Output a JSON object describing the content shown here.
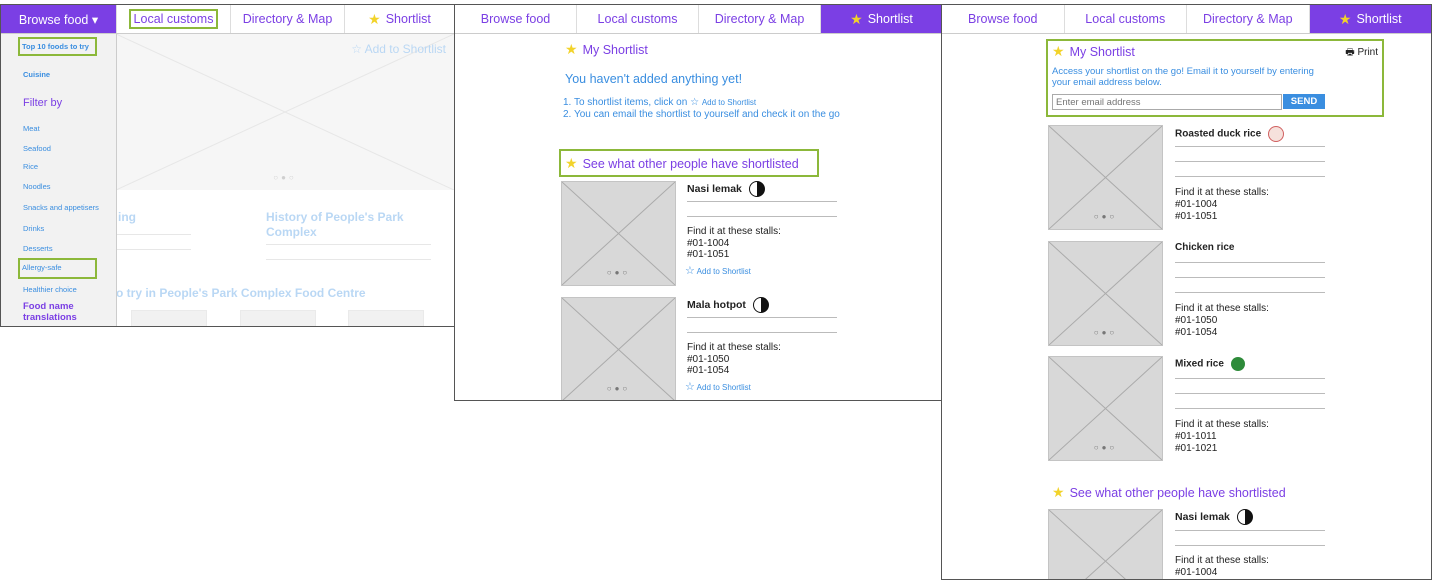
{
  "nav": {
    "browse_food": "Browse food",
    "browse_food_dropdown": "Browse food ▾",
    "local_customs": "Local customs",
    "directory_map": "Directory & Map",
    "shortlist": "Shortlist"
  },
  "panel1": {
    "menu": {
      "top10": "Top 10 foods to try",
      "cuisine": "Cuisine",
      "filter_by": "Filter by",
      "items": [
        "Meat",
        "Seafood",
        "Rice",
        "Noodles",
        "Snacks and appetisers",
        "Drinks",
        "Desserts",
        "Allergy-safe",
        "Healthier choice"
      ],
      "food_name_translations": "Food name translations"
    },
    "add_to_shortlist": "Add to Shortlist",
    "faded_heading_1": "ing",
    "faded_heading_2": "History of People's Park Complex",
    "faded_heading_3": "o try in People's Park Complex Food Centre"
  },
  "panel2": {
    "my_shortlist": "My Shortlist",
    "empty_msg": "You haven't added anything yet!",
    "instr1_pre": "1. To shortlist items, click on",
    "instr1_link": "Add to Shortlist",
    "instr2": "2. You can email the shortlist to yourself and check it on the go",
    "others_heading": "See what other people have shortlisted",
    "items": [
      {
        "name": "Nasi lemak",
        "stalls_label": "Find it at these stalls:",
        "stalls": [
          "#01-1004",
          "#01-1051"
        ],
        "add": "Add to Shortlist"
      },
      {
        "name": "Mala hotpot",
        "stalls_label": "Find it at these stalls:",
        "stalls": [
          "#01-1050",
          "#01-1054"
        ],
        "add": "Add to Shortlist"
      }
    ]
  },
  "panel3": {
    "my_shortlist": "My Shortlist",
    "print": "Print",
    "email_desc": "Access your shortlist on the go! Email it to yourself by entering your email address below.",
    "email_placeholder": "Enter email address",
    "send": "SEND",
    "items": [
      {
        "name": "Roasted duck rice",
        "stalls_label": "Find it at these stalls:",
        "stalls": [
          "#01-1004",
          "#01-1051"
        ]
      },
      {
        "name": "Chicken rice",
        "stalls_label": "Find it at these stalls:",
        "stalls": [
          "#01-1050",
          "#01-1054"
        ]
      },
      {
        "name": "Mixed rice",
        "stalls_label": "Find it at these stalls:",
        "stalls": [
          "#01-1011",
          "#01-1021"
        ]
      }
    ],
    "others_heading": "See what other people have shortlisted",
    "others_item": {
      "name": "Nasi lemak",
      "stalls_label": "Find it at these stalls:",
      "stall1": "#01-1004"
    }
  },
  "colors": {
    "accent": "#7b3fe4",
    "link": "#3a8ee0",
    "highlight": "#8cb83a",
    "star": "#f2d32a"
  },
  "icons": {
    "star": "star-icon",
    "print": "printer-icon",
    "yin_yang": "yin-yang-icon",
    "halal": "halal-icon",
    "veg": "vegetarian-icon"
  }
}
